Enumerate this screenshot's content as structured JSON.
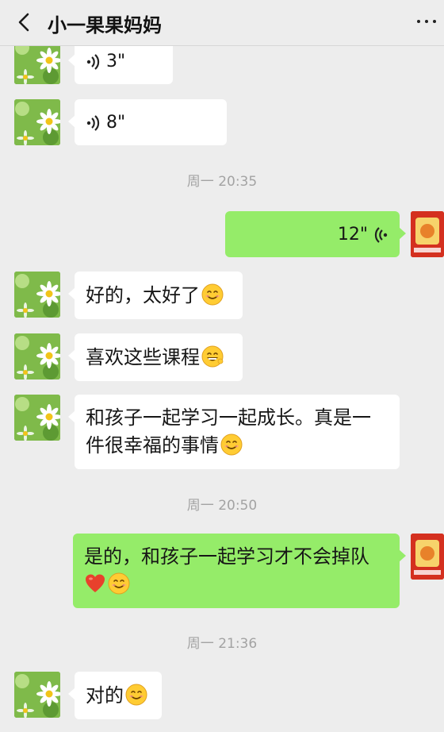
{
  "header": {
    "title": "小一果果妈妈"
  },
  "timestamps": [
    "周一 20:35",
    "周一 20:50",
    "周一 21:36"
  ],
  "messages": [
    {
      "side": "in",
      "type": "voice",
      "duration": "3\""
    },
    {
      "side": "in",
      "type": "voice",
      "duration": "8\""
    },
    {
      "side": "out",
      "type": "voice",
      "duration": "12\""
    },
    {
      "side": "in",
      "type": "text",
      "text": "好的，太好了",
      "emoji": "smile-emoji"
    },
    {
      "side": "in",
      "type": "text",
      "text": "喜欢这些课程",
      "emoji": "grin-emoji"
    },
    {
      "side": "in",
      "type": "text",
      "line1": "和孩子一起学习一起成长。真是一",
      "line2": "件很幸福的事情",
      "emoji": "smile-emoji"
    },
    {
      "side": "out",
      "type": "text",
      "line1": "是的，和孩子一起学习才不会掉队",
      "emoji": [
        "heart-emoji",
        "smile-emoji"
      ]
    },
    {
      "side": "in",
      "type": "text",
      "text": "对的",
      "emoji": "smile-emoji"
    }
  ],
  "colors": {
    "background": "#ededed",
    "incoming_bubble": "#ffffff",
    "outgoing_bubble": "#95ec69",
    "timestamp": "#a3a3a3"
  }
}
